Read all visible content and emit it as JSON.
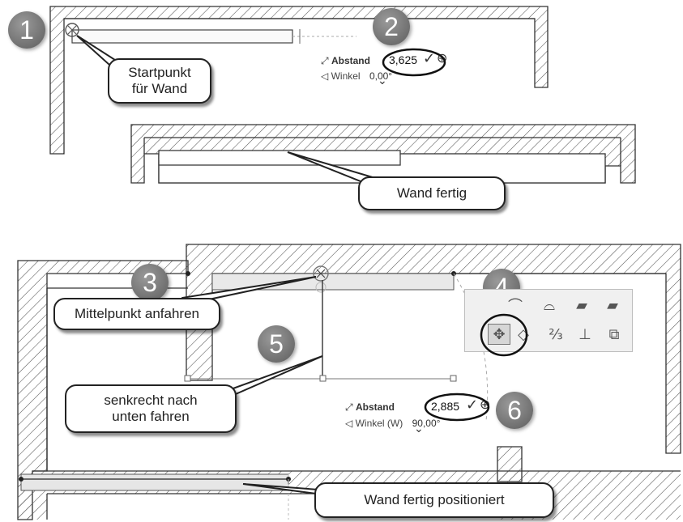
{
  "steps": [
    "1",
    "2",
    "3",
    "4",
    "5",
    "6"
  ],
  "callouts": {
    "startpunkt": "Startpunkt\nfür Wand",
    "wand_fertig": "Wand fertig",
    "mittelpunkt": "Mittelpunkt anfahren",
    "senkrecht": "senkrecht nach\nunten fahren",
    "wand_positioniert": "Wand fertig positioniert"
  },
  "readout_top": {
    "abstand_label": "Abstand",
    "abstand_value": "3,625",
    "winkel_label": "Winkel",
    "winkel_value": "0,00°"
  },
  "readout_bottom": {
    "abstand_label": "Abstand",
    "abstand_value": "2,885",
    "winkel_label": "Winkel (W)",
    "winkel_value": "90,00°"
  },
  "icons": {
    "check": "✓",
    "crosshair": "⊕",
    "chevron": "⌄"
  },
  "colors": {
    "callout_border": "#222222",
    "step_badge": "#7a7a7a",
    "wall_hatch": "#555555"
  }
}
